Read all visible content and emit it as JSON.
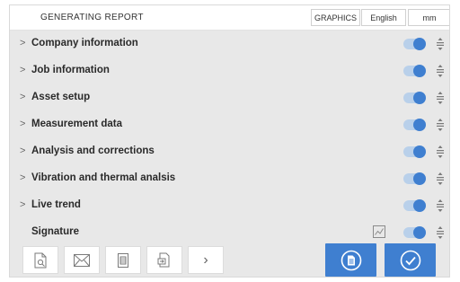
{
  "header": {
    "title": "GENERATING REPORT",
    "graphics_label": "GRAPHICS",
    "language_label": "English",
    "unit_label": "mm"
  },
  "sections": [
    {
      "label": "Company information",
      "expandable": true,
      "enabled": true
    },
    {
      "label": "Job information",
      "expandable": true,
      "enabled": true
    },
    {
      "label": "Asset setup",
      "expandable": true,
      "enabled": true
    },
    {
      "label": "Measurement data",
      "expandable": true,
      "enabled": true
    },
    {
      "label": "Analysis and corrections",
      "expandable": true,
      "enabled": true
    },
    {
      "label": "Vibration and thermal analsis",
      "expandable": true,
      "enabled": true
    },
    {
      "label": "Live trend",
      "expandable": true,
      "enabled": true
    },
    {
      "label": "Signature",
      "expandable": false,
      "enabled": true
    }
  ],
  "toolbar": {
    "chevron_glyph": "›",
    "icons": [
      "preview-icon",
      "email-icon",
      "document-icon",
      "export-icon",
      "chevron-right-icon"
    ],
    "primary_icons": [
      "save-report-icon",
      "confirm-check-icon"
    ]
  },
  "colors": {
    "accent": "#3f7fd0",
    "toggle_track": "#b9d0ea",
    "background": "#e8e8e8"
  }
}
